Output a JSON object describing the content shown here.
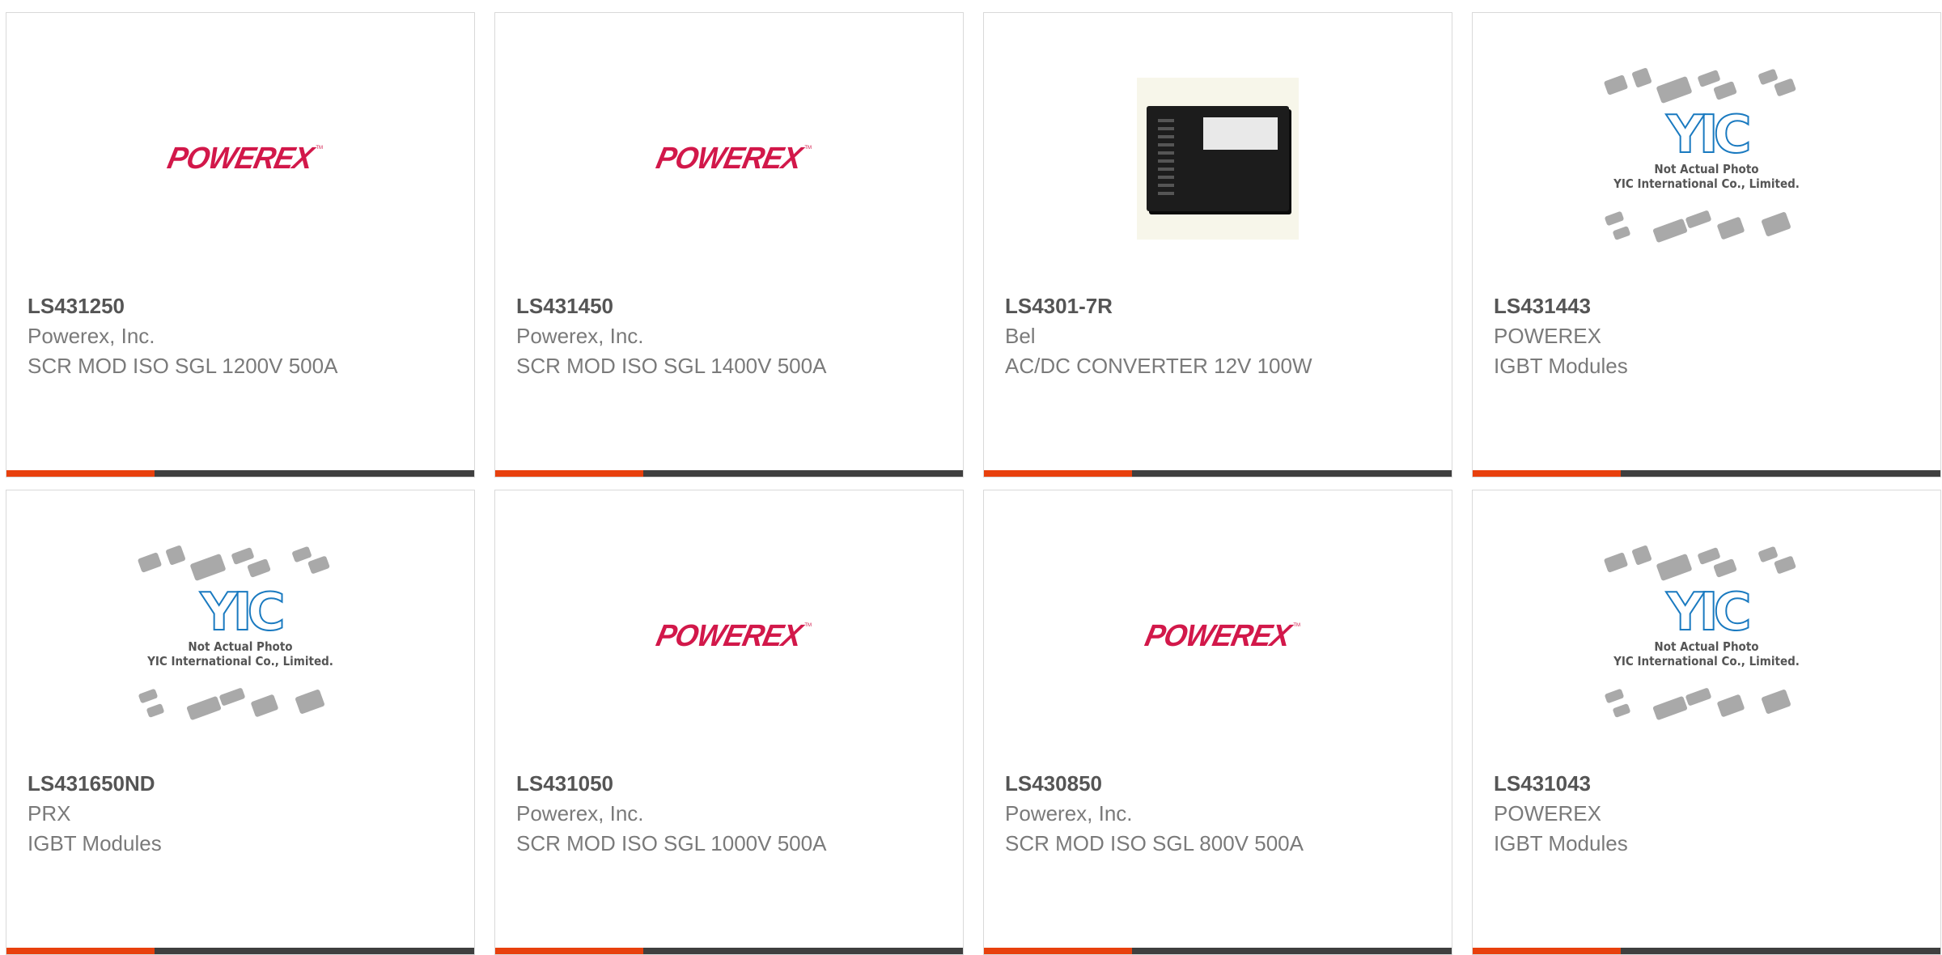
{
  "products": [
    {
      "part": "LS431250",
      "manufacturer": "Powerex, Inc.",
      "description": "SCR MOD ISO SGL 1200V 500A",
      "image": "powerex-logo",
      "image_text": "POWEREX"
    },
    {
      "part": "LS431450",
      "manufacturer": "Powerex, Inc.",
      "description": "SCR MOD ISO SGL 1400V 500A",
      "image": "powerex-logo",
      "image_text": "POWEREX"
    },
    {
      "part": "LS4301-7R",
      "manufacturer": "Bel",
      "description": "AC/DC CONVERTER 12V 100W",
      "image": "product-photo"
    },
    {
      "part": "LS431443",
      "manufacturer": "POWEREX",
      "description": "IGBT Modules",
      "image": "yic-placeholder",
      "image_text": "YIC",
      "caption1": "Not Actual Photo",
      "caption2": "YIC International Co., Limited."
    },
    {
      "part": "LS431650ND",
      "manufacturer": "PRX",
      "description": "IGBT Modules",
      "image": "yic-placeholder",
      "image_text": "YIC",
      "caption1": "Not Actual Photo",
      "caption2": "YIC International Co., Limited."
    },
    {
      "part": "LS431050",
      "manufacturer": "Powerex, Inc.",
      "description": "SCR MOD ISO SGL 1000V 500A",
      "image": "powerex-logo",
      "image_text": "POWEREX"
    },
    {
      "part": "LS430850",
      "manufacturer": "Powerex, Inc.",
      "description": "SCR MOD ISO SGL 800V 500A",
      "image": "powerex-logo",
      "image_text": "POWEREX"
    },
    {
      "part": "LS431043",
      "manufacturer": "POWEREX",
      "description": "IGBT Modules",
      "image": "yic-placeholder",
      "image_text": "YIC",
      "caption1": "Not Actual Photo",
      "caption2": "YIC International Co., Limited."
    }
  ],
  "colors": {
    "accent": "#e8400d",
    "bar": "#3f3f3f",
    "logo_red": "#d2184a",
    "yic_blue": "#1a7ac0"
  }
}
